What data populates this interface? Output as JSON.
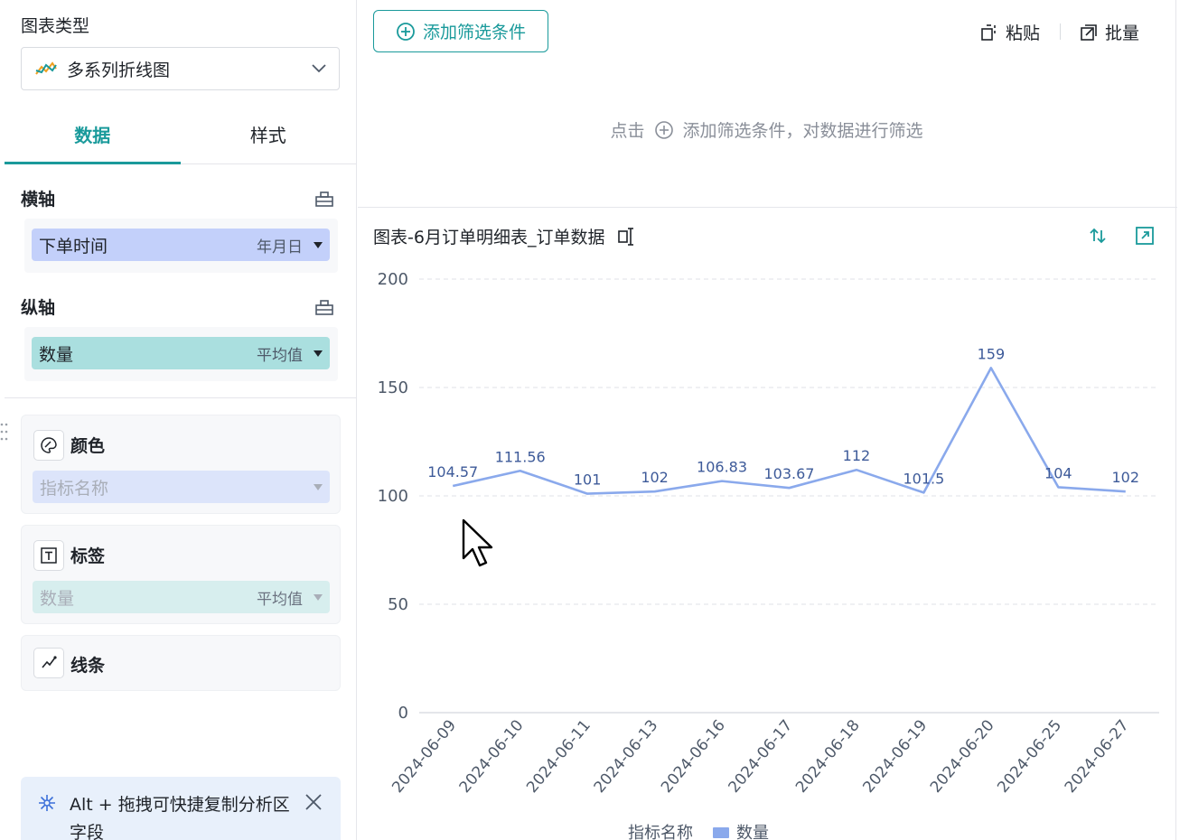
{
  "sidebar": {
    "chart_type_label": "图表类型",
    "chart_type_value": "多系列折线图",
    "tabs": [
      {
        "label": "数据"
      },
      {
        "label": "样式"
      }
    ],
    "x_axis": {
      "title": "横轴",
      "field": "下单时间",
      "agg": "年月日"
    },
    "y_axis": {
      "title": "纵轴",
      "field": "数量",
      "agg": "平均值"
    },
    "color_card": {
      "title": "颜色",
      "placeholder": "指标名称"
    },
    "label_card": {
      "title": "标签",
      "field": "数量",
      "agg": "平均值"
    },
    "line_card": {
      "title": "线条"
    },
    "tip": {
      "text": "Alt + 拖拽可快捷复制分析区字段"
    }
  },
  "filter": {
    "add_button": "添加筛选条件",
    "paste": "粘贴",
    "batch": "批量",
    "hint_prefix": "点击",
    "hint_suffix": "添加筛选条件，对数据进行筛选"
  },
  "chart_header": {
    "title": "图表-6月订单明细表_订单数据"
  },
  "colors": {
    "accent": "#1a9a9b",
    "series": "#8aa9ec",
    "x_pill": "#c3d0fa",
    "y_pill": "#aadfdf"
  },
  "chart_data": {
    "type": "line",
    "categories": [
      "2024-06-09",
      "2024-06-10",
      "2024-06-11",
      "2024-06-13",
      "2024-06-16",
      "2024-06-17",
      "2024-06-18",
      "2024-06-19",
      "2024-06-20",
      "2024-06-25",
      "2024-06-27"
    ],
    "series": [
      {
        "name": "数量",
        "values": [
          104.57,
          111.56,
          101,
          102,
          106.83,
          103.67,
          112,
          101.5,
          159,
          104,
          102
        ]
      }
    ],
    "data_labels": [
      "104.57",
      "111.56",
      "101",
      "102",
      "106.83",
      "103.67",
      "112",
      "101.5",
      "159",
      "104",
      "102"
    ],
    "ylim": [
      0,
      200
    ],
    "yticks": [
      0,
      50,
      100,
      150,
      200
    ],
    "grid": true,
    "legend": {
      "title": "指标名称",
      "position": "bottom"
    }
  }
}
